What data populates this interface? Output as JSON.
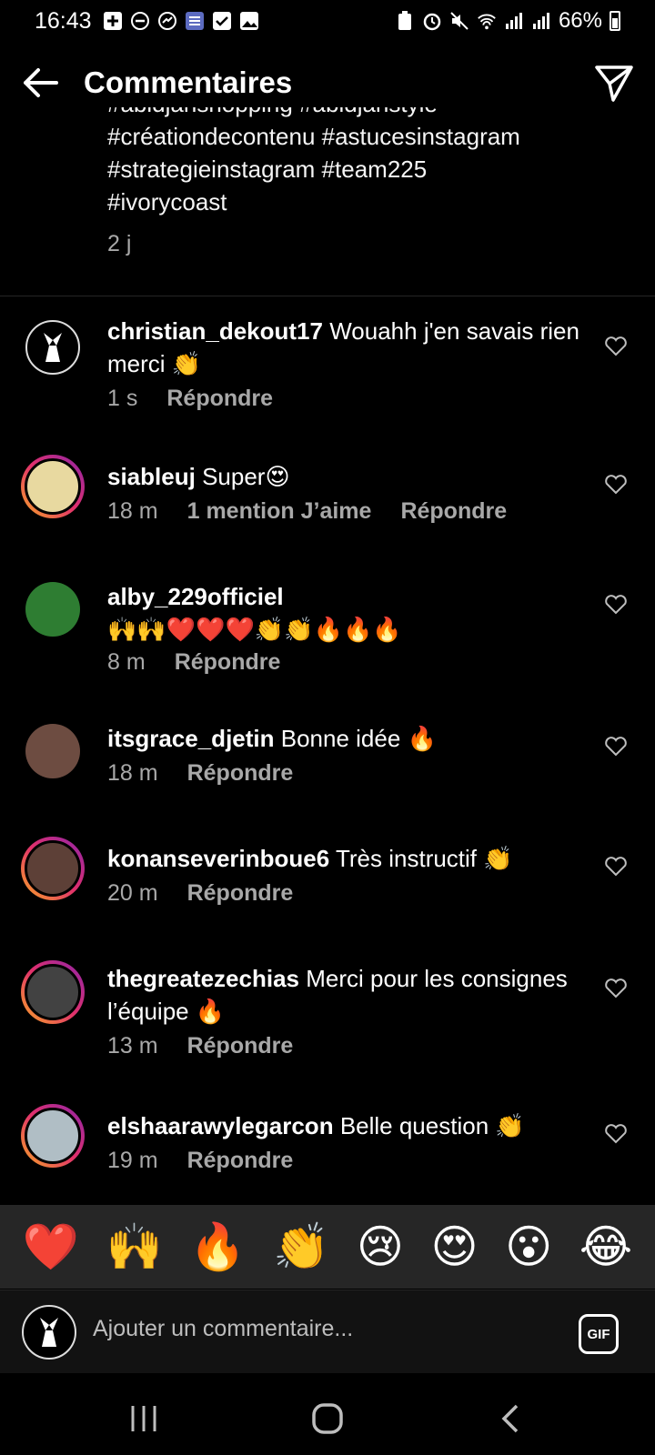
{
  "status_bar": {
    "time": "16:43",
    "battery": "66%"
  },
  "header": {
    "title": "Commentaires"
  },
  "caption": {
    "lines": [
      "#abidjanshopping #abidjanstyle",
      "#créationdecontenu #astucesinstagram",
      "#strategieinstagram #team225",
      "#ivorycoast"
    ],
    "age": "2 j"
  },
  "comments": [
    {
      "user": "christian_dekout17",
      "text": "Wouahh j'en savais rien merci 👏",
      "time": "1 s",
      "likes": "",
      "reply": "Répondre"
    },
    {
      "user": "siableuj",
      "text": "Super😍",
      "time": "18 m",
      "likes": "1 mention J’aime",
      "reply": "Répondre"
    },
    {
      "user": "alby_229officiel",
      "text": "🙌🙌❤️❤️❤️👏👏🔥🔥🔥",
      "time": "8 m",
      "likes": "",
      "reply": "Répondre"
    },
    {
      "user": "itsgrace_djetin",
      "text": "Bonne idée 🔥",
      "time": "18 m",
      "likes": "",
      "reply": "Répondre"
    },
    {
      "user": "konanseverinboue6",
      "text": "Très instructif 👏",
      "time": "20 m",
      "likes": "",
      "reply": "Répondre"
    },
    {
      "user": "thegreatezechias",
      "text": "Merci pour les consignes l’équipe 🔥",
      "time": "13 m",
      "likes": "",
      "reply": "Répondre"
    },
    {
      "user": "elshaarawylegarcon",
      "text": "Belle question 👏",
      "time": "19 m",
      "likes": "",
      "reply": "Répondre"
    }
  ],
  "emoji_bar": [
    "❤️",
    "🙌",
    "🔥",
    "👏",
    "😢",
    "😍",
    "😮",
    "😂"
  ],
  "input": {
    "placeholder": "Ajouter un commentaire...",
    "gif_label": "GIF"
  },
  "colors": {
    "background": "#000000",
    "secondary_text": "#a8a8a8",
    "emoji_bar_bg": "#262626"
  }
}
